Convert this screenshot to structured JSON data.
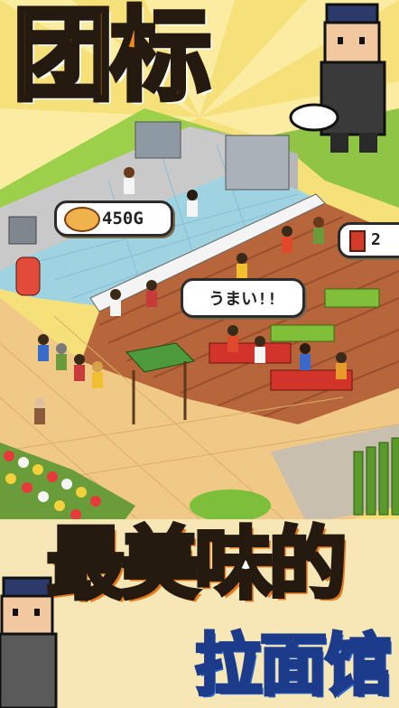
{
  "title": "团标",
  "tagline": "最美味的",
  "subtitle": "拉面馆",
  "price_bubble": {
    "price": "450G"
  },
  "speech_bubble": {
    "text": "うまい!!"
  },
  "stat_bubble": {
    "value": "2"
  },
  "colors": {
    "title_fill": "#f08a14",
    "outline": "#241a10",
    "floor_wood": "#b7653a",
    "kitchen_tile": "#9fd3e2",
    "grass": "#9ccf4a",
    "subtitle_fill": "#2a63c9"
  }
}
